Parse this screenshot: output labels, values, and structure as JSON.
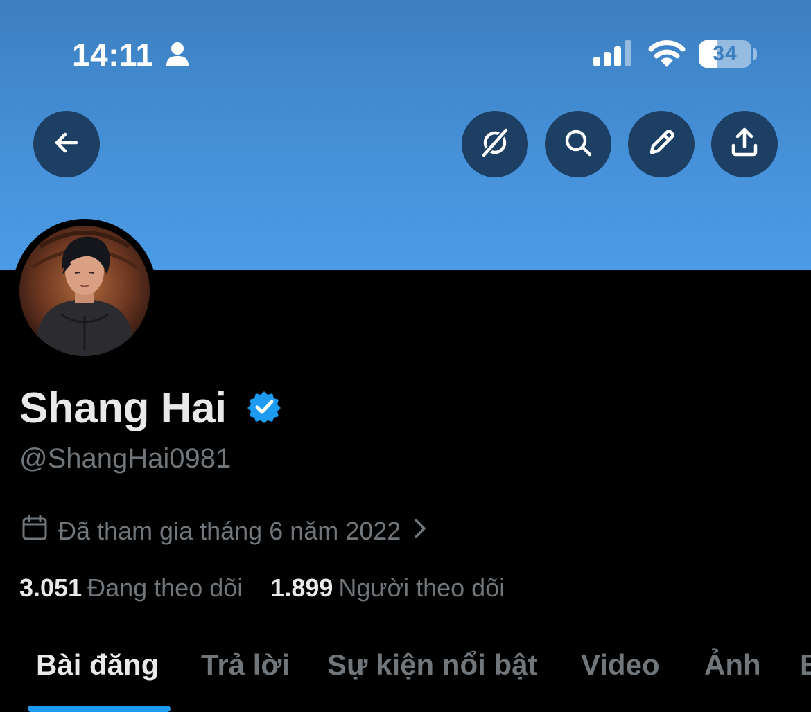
{
  "status_bar": {
    "time": "14:11",
    "battery": "34",
    "battery_level_percent": 34,
    "icons": [
      "person-icon",
      "cellular-signal-icon",
      "wifi-icon",
      "battery-icon"
    ]
  },
  "header_buttons": {
    "back": "back-arrow-icon",
    "actions": [
      "grok-icon",
      "search-icon",
      "edit-pencil-icon",
      "share-icon"
    ]
  },
  "profile": {
    "display_name": "Shang Hai",
    "handle": "@ShangHai0981",
    "joined": "Đã tham gia tháng 6 năm 2022",
    "following_count": "3.051",
    "following_label": "Đang theo dõi",
    "followers_count": "1.899",
    "followers_label": "Người theo dõi"
  },
  "tabs": [
    {
      "label": "Bài đăng",
      "active": true
    },
    {
      "label": "Trả lời",
      "active": false
    },
    {
      "label": "Sự kiện nổi bật",
      "active": false
    },
    {
      "label": "Video",
      "active": false
    },
    {
      "label": "Ảnh",
      "active": false
    },
    {
      "label": "B",
      "active": false
    }
  ],
  "colors": {
    "banner": "#4690d8",
    "accent": "#1d9bf0",
    "muted_text": "#71767b",
    "button_bg": "#1d3f63"
  }
}
